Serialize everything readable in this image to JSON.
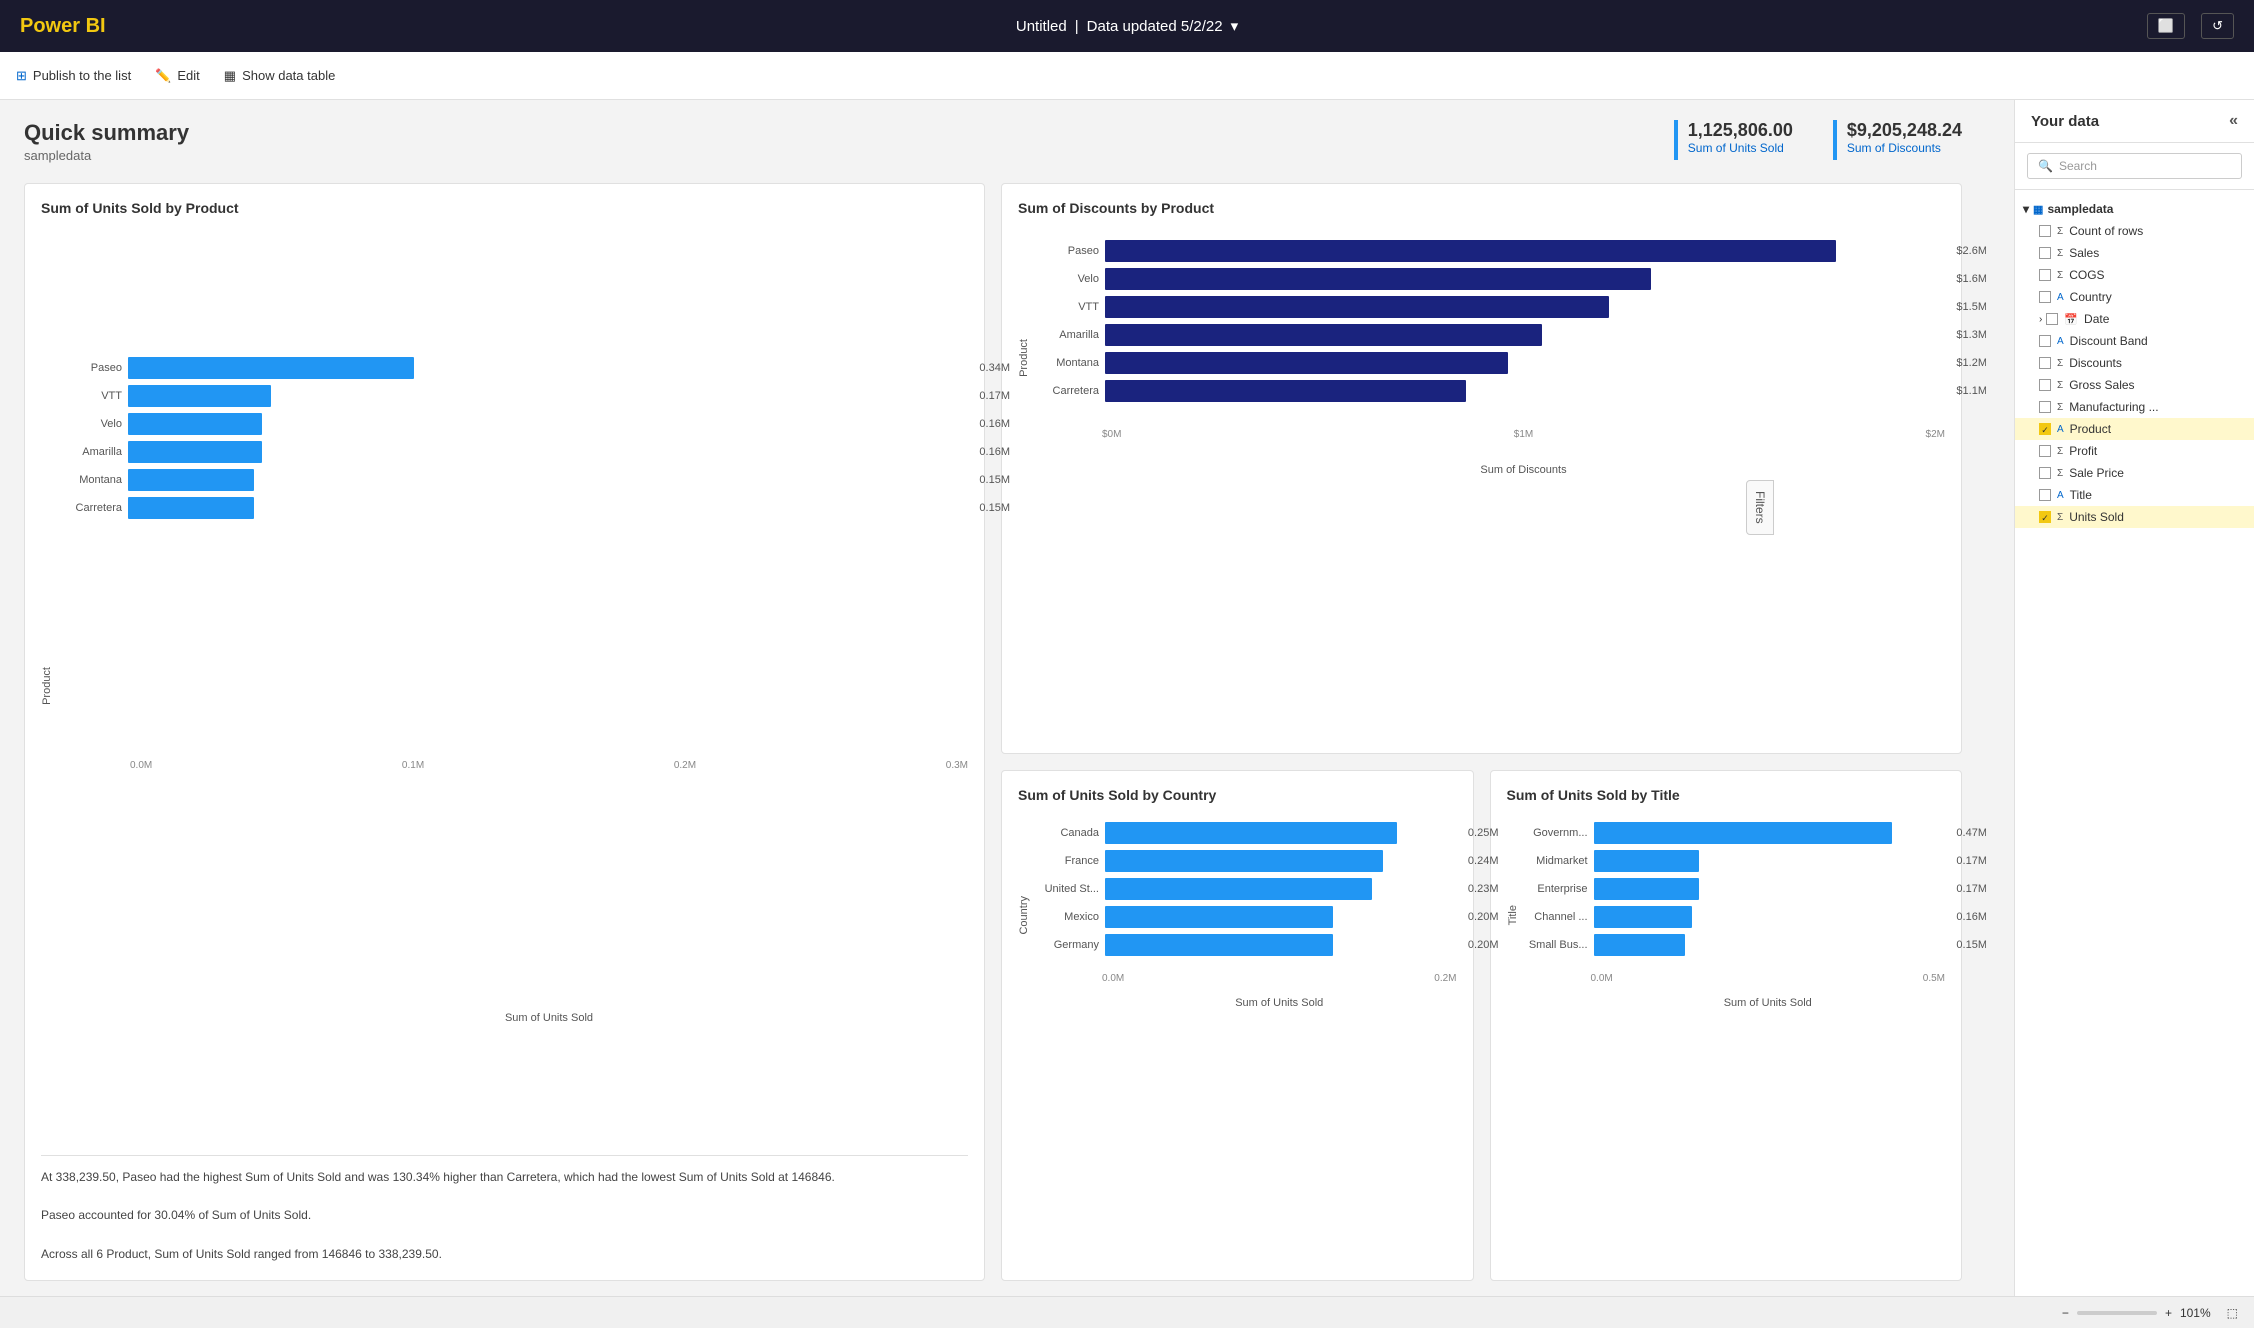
{
  "topbar": {
    "logo": "Power BI",
    "title": "Untitled",
    "data_updated": "Data updated 5/2/22",
    "dropdown_icon": "▾"
  },
  "toolbar": {
    "publish_label": "Publish to the list",
    "edit_label": "Edit",
    "show_data_label": "Show data table"
  },
  "summary": {
    "title": "Quick summary",
    "subtitle": "sampledata",
    "kpi1_value": "1,125,806.00",
    "kpi1_label": "Sum of Units Sold",
    "kpi2_value": "$9,205,248.24",
    "kpi2_label": "Sum of Discounts"
  },
  "chart1": {
    "title": "Sum of Units Sold by Product",
    "x_label": "Sum of Units Sold",
    "y_label": "Product",
    "axis_values": [
      "0.0M",
      "0.1M",
      "0.2M",
      "0.3M"
    ],
    "bars": [
      {
        "label": "Paseo",
        "value": 0.34,
        "display": "0.34M",
        "color": "#2196f3"
      },
      {
        "label": "VTT",
        "value": 0.17,
        "display": "0.17M",
        "color": "#2196f3"
      },
      {
        "label": "Velo",
        "value": 0.16,
        "display": "0.16M",
        "color": "#2196f3"
      },
      {
        "label": "Amarilla",
        "value": 0.16,
        "display": "0.16M",
        "color": "#2196f3"
      },
      {
        "label": "Montana",
        "value": 0.15,
        "display": "0.15M",
        "color": "#2196f3"
      },
      {
        "label": "Carretera",
        "value": 0.15,
        "display": "0.15M",
        "color": "#2196f3"
      }
    ],
    "desc1": "At 338,239.50, Paseo had the highest Sum of Units Sold and was 130.34% higher than Carretera, which had the lowest Sum of Units Sold at 146846.",
    "desc2": "Paseo accounted for 30.04% of Sum of Units Sold.",
    "desc3": "Across all 6 Product, Sum of Units Sold ranged from 146846 to 338,239.50."
  },
  "chart2": {
    "title": "Sum of Discounts by Product",
    "x_label": "Sum of Discounts",
    "y_label": "Product",
    "axis_values": [
      "$0M",
      "$1M",
      "$2M"
    ],
    "bars": [
      {
        "label": "Paseo",
        "value": 0.87,
        "display": "$2.6M",
        "color": "#1a237e"
      },
      {
        "label": "Velo",
        "value": 0.65,
        "display": "$1.6M",
        "color": "#1a237e"
      },
      {
        "label": "VTT",
        "value": 0.6,
        "display": "$1.5M",
        "color": "#1a237e"
      },
      {
        "label": "Amarilla",
        "value": 0.52,
        "display": "$1.3M",
        "color": "#1a237e"
      },
      {
        "label": "Montana",
        "value": 0.48,
        "display": "$1.2M",
        "color": "#1a237e"
      },
      {
        "label": "Carretera",
        "value": 0.43,
        "display": "$1.1M",
        "color": "#1a237e"
      }
    ]
  },
  "chart3": {
    "title": "Sum of Units Sold by Country",
    "x_label": "Sum of Units Sold",
    "y_label": "Country",
    "axis_values": [
      "0.0M",
      "0.2M"
    ],
    "bars": [
      {
        "label": "Canada",
        "value": 0.83,
        "display": "0.25M",
        "color": "#2196f3"
      },
      {
        "label": "France",
        "value": 0.79,
        "display": "0.24M",
        "color": "#2196f3"
      },
      {
        "label": "United St...",
        "value": 0.76,
        "display": "0.23M",
        "color": "#2196f3"
      },
      {
        "label": "Mexico",
        "value": 0.65,
        "display": "0.20M",
        "color": "#2196f3"
      },
      {
        "label": "Germany",
        "value": 0.65,
        "display": "0.20M",
        "color": "#2196f3"
      }
    ]
  },
  "chart4": {
    "title": "Sum of Units Sold by Title",
    "x_label": "Sum of Units Sold",
    "y_label": "Title",
    "axis_values": [
      "0.0M",
      "0.5M"
    ],
    "bars": [
      {
        "label": "Governm...",
        "value": 0.85,
        "display": "0.47M",
        "color": "#2196f3"
      },
      {
        "label": "Midmarket",
        "value": 0.3,
        "display": "0.17M",
        "color": "#2196f3"
      },
      {
        "label": "Enterprise",
        "value": 0.3,
        "display": "0.17M",
        "color": "#2196f3"
      },
      {
        "label": "Channel ...",
        "value": 0.28,
        "display": "0.16M",
        "color": "#2196f3"
      },
      {
        "label": "Small Bus...",
        "value": 0.26,
        "display": "0.15M",
        "color": "#2196f3"
      }
    ]
  },
  "right_panel": {
    "title": "Your data",
    "search_placeholder": "Search",
    "data_source": "sampledata",
    "fields": [
      {
        "name": "Count of rows",
        "type": "count",
        "checked": false
      },
      {
        "name": "Sales",
        "type": "sigma",
        "checked": false
      },
      {
        "name": "COGS",
        "type": "sigma",
        "checked": false
      },
      {
        "name": "Country",
        "type": "text",
        "checked": false
      },
      {
        "name": "Date",
        "type": "date",
        "checked": false,
        "expandable": true
      },
      {
        "name": "Discount Band",
        "type": "text",
        "checked": false
      },
      {
        "name": "Discounts",
        "type": "sigma",
        "checked": false
      },
      {
        "name": "Gross Sales",
        "type": "sigma",
        "checked": false
      },
      {
        "name": "Manufacturing ...",
        "type": "sigma",
        "checked": false
      },
      {
        "name": "Product",
        "type": "text",
        "checked": true,
        "highlighted": true
      },
      {
        "name": "Profit",
        "type": "sigma",
        "checked": false
      },
      {
        "name": "Sale Price",
        "type": "sigma",
        "checked": false
      },
      {
        "name": "Title",
        "type": "text",
        "checked": false
      },
      {
        "name": "Units Sold",
        "type": "sigma",
        "checked": true,
        "highlighted": true
      }
    ]
  },
  "bottom_bar": {
    "zoom": "101%"
  }
}
